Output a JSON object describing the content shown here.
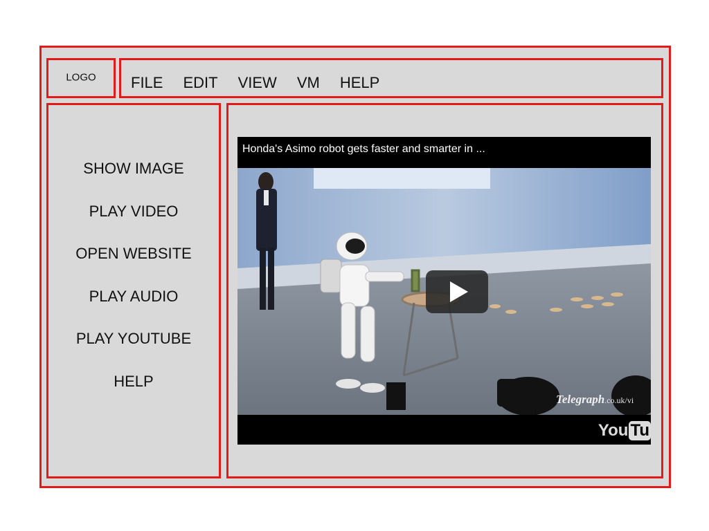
{
  "logo": {
    "label": "LOGO"
  },
  "menu": {
    "items": [
      {
        "label": "FILE"
      },
      {
        "label": "EDIT"
      },
      {
        "label": "VIEW"
      },
      {
        "label": "VM"
      },
      {
        "label": "HELP"
      }
    ]
  },
  "sidebar": {
    "items": [
      {
        "label": "SHOW IMAGE"
      },
      {
        "label": "PLAY VIDEO"
      },
      {
        "label": "OPEN WEBSITE"
      },
      {
        "label": "PLAY AUDIO"
      },
      {
        "label": "PLAY YOUTUBE"
      },
      {
        "label": "HELP"
      }
    ]
  },
  "video": {
    "title": "Honda's Asimo robot gets faster and smarter in ...",
    "watermark_brand": "Telegraph",
    "watermark_suffix": ".co.uk/vi",
    "yt_logo_you": "You",
    "yt_logo_tube": "Tu",
    "play_icon": "play-icon"
  },
  "colors": {
    "frame_border": "#e21a1a",
    "panel_background": "#d9d9d9",
    "player_background": "#000000"
  }
}
